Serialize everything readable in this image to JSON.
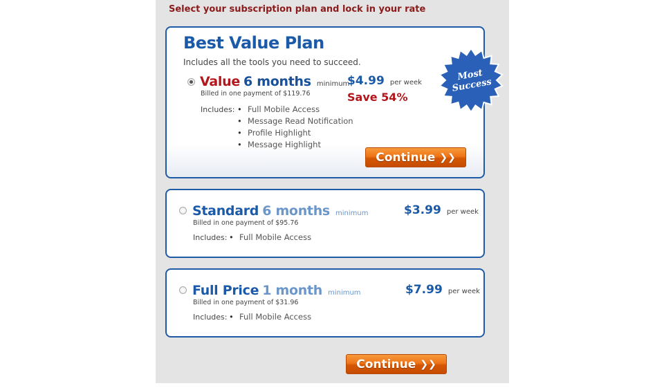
{
  "heading": "Select your subscription plan and lock in your rate",
  "best_value": {
    "title": "Best Value Plan",
    "subtitle": "Includes all the tools you need to succeed.",
    "badge": {
      "line1": "Most",
      "line2": "Success",
      "color": "#2a60b8"
    },
    "plan": {
      "name": "Value",
      "duration": "6 months",
      "minimum": "minimum",
      "billed": "Billed in one payment of $119.76",
      "price": "$4.99",
      "per_week": "per week",
      "save": "Save 54%",
      "selected": true,
      "includes_label": "Includes:",
      "features": [
        "Full Mobile Access",
        "Message Read Notification",
        "Profile Highlight",
        "Message Highlight"
      ]
    },
    "continue_label": "Continue"
  },
  "standard": {
    "name": "Standard",
    "duration": "6 months",
    "minimum": "minimum",
    "billed": "Billed in one payment of $95.76",
    "price": "$3.99",
    "per_week": "per week",
    "selected": false,
    "includes_label": "Includes:",
    "features": [
      "Full Mobile Access"
    ]
  },
  "full_price": {
    "name": "Full Price",
    "duration": "1 month",
    "minimum": "minimum",
    "billed": "Billed in one payment of $31.96",
    "price": "$7.99",
    "per_week": "per week",
    "selected": false,
    "includes_label": "Includes:",
    "features": [
      "Full Mobile Access"
    ]
  },
  "footer": {
    "continue_label": "Continue"
  },
  "colors": {
    "heading": "#8b1a1a",
    "brand_blue": "#1a5aa8",
    "accent_red": "#b3161b",
    "button_orange": "#ef7418"
  }
}
